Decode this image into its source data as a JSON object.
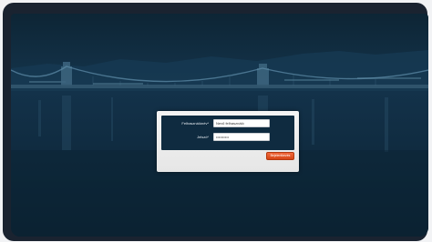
{
  "login": {
    "username_label": "Felhasználónév*",
    "username_value": "Nevű felhasználó",
    "password_label": "Jelszó*",
    "password_value": "••••••••••",
    "submit_label": "Bejelentkezés"
  },
  "colors": {
    "accent": "#e2541f",
    "panel_background": "#0f2b40",
    "backdrop": "#0d2535"
  }
}
